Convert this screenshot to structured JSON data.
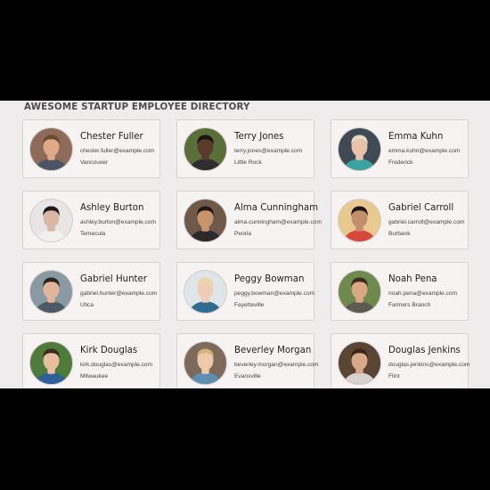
{
  "directory": {
    "title": "AWESOME STARTUP EMPLOYEE DIRECTORY",
    "employees": [
      {
        "name": "Chester Fuller",
        "email": "chester.fuller@example.com",
        "city": "Vancouver",
        "photo": {
          "bg": "#8e6b58",
          "skin": "#e0a989",
          "hair": "#6b4a34",
          "shirt": "#4b5563"
        }
      },
      {
        "name": "Terry Jones",
        "email": "terry.jones@example.com",
        "city": "Little Rock",
        "photo": {
          "bg": "#5a6e3a",
          "skin": "#5a3a28",
          "hair": "#1a1410",
          "shirt": "#2e2e2e"
        }
      },
      {
        "name": "Emma Kuhn",
        "email": "emma.kuhn@example.com",
        "city": "Frederick",
        "photo": {
          "bg": "#3f4a55",
          "skin": "#eac2ab",
          "hair": "#e6d9c6",
          "shirt": "#3aa5a0"
        }
      },
      {
        "name": "Ashley Burton",
        "email": "ashley.burton@example.com",
        "city": "Temecula",
        "photo": {
          "bg": "#e9e4e6",
          "skin": "#d8b7a5",
          "hair": "#1f1a1a",
          "shirt": "#f2eff0"
        }
      },
      {
        "name": "Alma Cunningham",
        "email": "alma.cunningham@example.com",
        "city": "Peoria",
        "photo": {
          "bg": "#6f5a4a",
          "skin": "#c8946c",
          "hair": "#231812",
          "shirt": "#2a2a2a"
        }
      },
      {
        "name": "Gabriel Carroll",
        "email": "gabriel.carroll@example.com",
        "city": "Burbank",
        "photo": {
          "bg": "#e8c98f",
          "skin": "#c28f6e",
          "hair": "#1e1612",
          "shirt": "#d9473c"
        }
      },
      {
        "name": "Gabriel Hunter",
        "email": "gabriel.hunter@example.com",
        "city": "Utica",
        "photo": {
          "bg": "#8a9aa3",
          "skin": "#e2b59b",
          "hair": "#2b2522",
          "shirt": "#4d5a63"
        }
      },
      {
        "name": "Peggy Bowman",
        "email": "peggy.bowman@example.com",
        "city": "Fayetteville",
        "photo": {
          "bg": "#dfe6ea",
          "skin": "#f0cdb6",
          "hair": "#e8d7a8",
          "shirt": "#2f6c8f"
        }
      },
      {
        "name": "Noah Pena",
        "email": "noah.pena@example.com",
        "city": "Farmers Branch",
        "photo": {
          "bg": "#6f8a4d",
          "skin": "#d9a783",
          "hair": "#3b2a1e",
          "shirt": "#5b5b52"
        }
      },
      {
        "name": "Kirk Douglas",
        "email": "kirk.douglas@example.com",
        "city": "Milwaukee",
        "photo": {
          "bg": "#4e7a3a",
          "skin": "#e8bda1",
          "hair": "#3a2a22",
          "shirt": "#2e5f9a"
        }
      },
      {
        "name": "Beverley Morgan",
        "email": "beverley.morgan@example.com",
        "city": "Evansville",
        "photo": {
          "bg": "#7c6a5a",
          "skin": "#f0c9ad",
          "hair": "#d8b27a",
          "shirt": "#5d8fb5"
        }
      },
      {
        "name": "Douglas Jenkins",
        "email": "douglas.jenkins@example.com",
        "city": "Flint",
        "photo": {
          "bg": "#5a4534",
          "skin": "#d8a988",
          "hair": "#3a2619",
          "shirt": "#d6d3ce"
        }
      }
    ]
  }
}
